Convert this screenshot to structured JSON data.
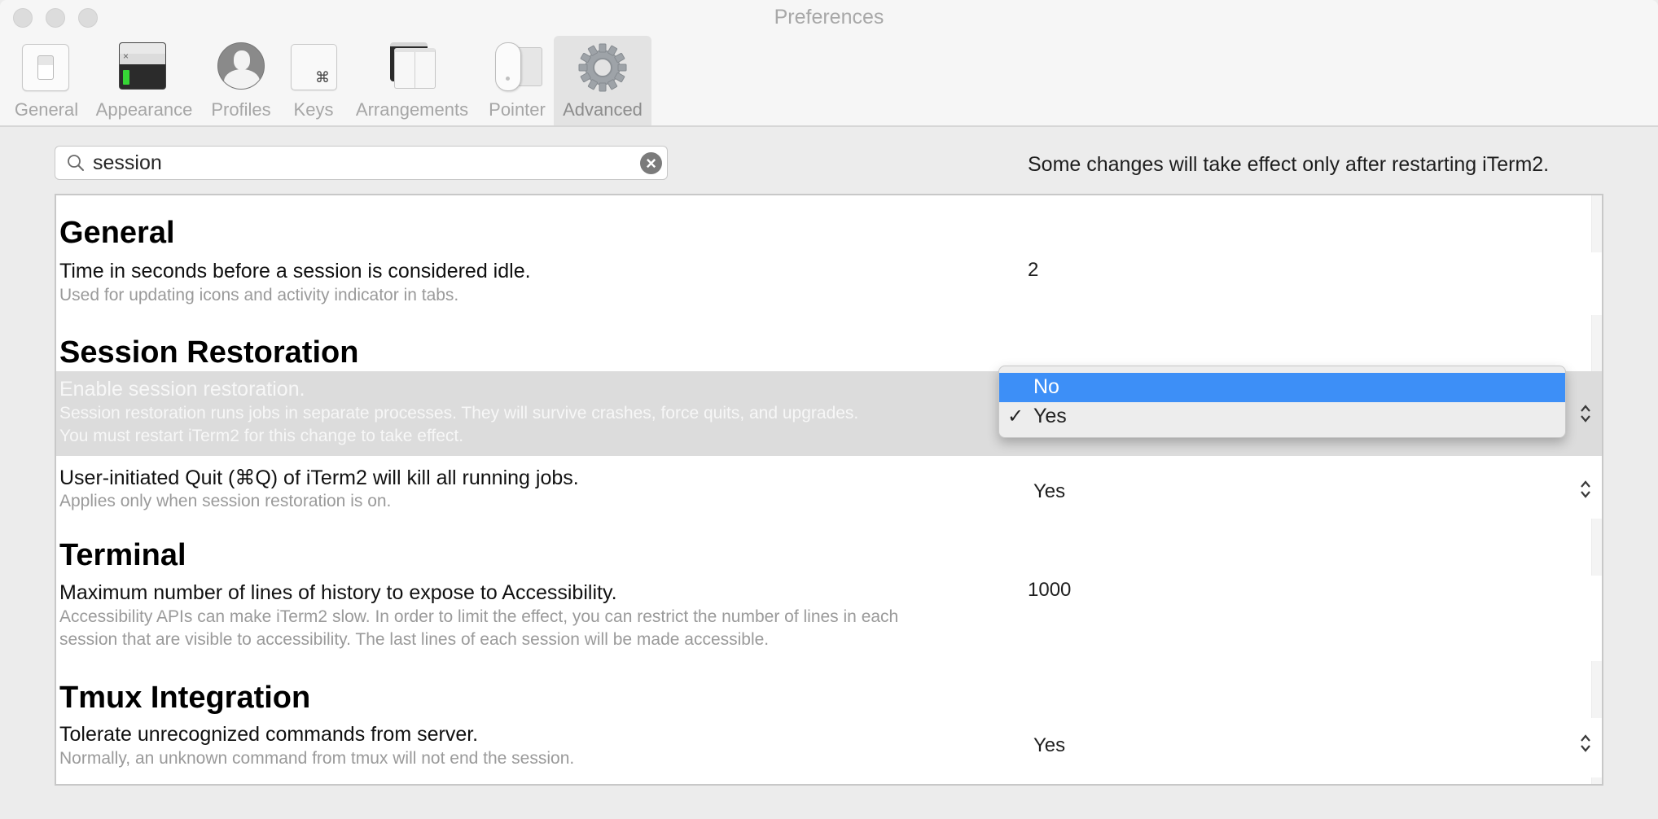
{
  "window": {
    "title": "Preferences",
    "controls": [
      "close",
      "minimize",
      "zoom"
    ]
  },
  "toolbar": {
    "tabs": [
      {
        "id": "general",
        "label": "General",
        "icon": "switch-icon",
        "selected": false
      },
      {
        "id": "appearance",
        "label": "Appearance",
        "icon": "terminal-window-icon",
        "selected": false
      },
      {
        "id": "profiles",
        "label": "Profiles",
        "icon": "user-silhouette-icon",
        "selected": false
      },
      {
        "id": "keys",
        "label": "Keys",
        "icon": "command-key-icon",
        "key_glyph": "⌘",
        "selected": false
      },
      {
        "id": "arrangements",
        "label": "Arrangements",
        "icon": "window-arrangement-icon",
        "selected": false
      },
      {
        "id": "pointer",
        "label": "Pointer",
        "icon": "mouse-icon",
        "selected": false
      },
      {
        "id": "advanced",
        "label": "Advanced",
        "icon": "gear-icon",
        "selected": true
      }
    ]
  },
  "search": {
    "value": "session",
    "placeholder": "",
    "clear_glyph": "×"
  },
  "restart_note": "Some changes will take effect only after restarting iTerm2.",
  "sections": [
    {
      "heading": "General",
      "settings": [
        {
          "title": "Time in seconds before a session is considered idle.",
          "subtitle": [
            "Used for updating icons and activity indicator in tabs."
          ],
          "value": "2",
          "control": "text"
        }
      ]
    },
    {
      "heading": "Session Restoration",
      "settings": [
        {
          "title": "Enable session restoration.",
          "subtitle": [
            "Session restoration runs jobs in separate processes. They will survive crashes, force quits, and upgrades.",
            "You must restart iTerm2 for this change to take effect."
          ],
          "value": "Yes",
          "control": "popup",
          "selected": true
        },
        {
          "title": "User-initiated Quit (⌘Q) of iTerm2 will kill all running jobs.",
          "subtitle": [
            "Applies only when session restoration is on."
          ],
          "value": "Yes",
          "control": "popup"
        }
      ]
    },
    {
      "heading": "Terminal",
      "settings": [
        {
          "title": "Maximum number of lines of history to expose to Accessibility.",
          "subtitle": [
            "Accessibility APIs can make iTerm2 slow. In order to limit the effect, you can restrict the number of lines in each",
            "session that are visible to accessibility. The last lines of each session will be made accessible."
          ],
          "value": "1000",
          "control": "text"
        }
      ]
    },
    {
      "heading": "Tmux Integration",
      "settings": [
        {
          "title": "Tolerate unrecognized commands from server.",
          "subtitle": [
            "Normally, an unknown command from tmux will not end the session."
          ],
          "value": "Yes",
          "control": "popup"
        }
      ]
    }
  ],
  "popup_menu": {
    "options": [
      {
        "label": "No",
        "checked": false,
        "highlighted": true
      },
      {
        "label": "Yes",
        "checked": true,
        "highlighted": false
      }
    ],
    "check_glyph": "✓"
  },
  "colors": {
    "menu_highlight": "#3d8ff7",
    "row_selection": "#dcdcdc",
    "appearance_cursor": "#36d636"
  }
}
